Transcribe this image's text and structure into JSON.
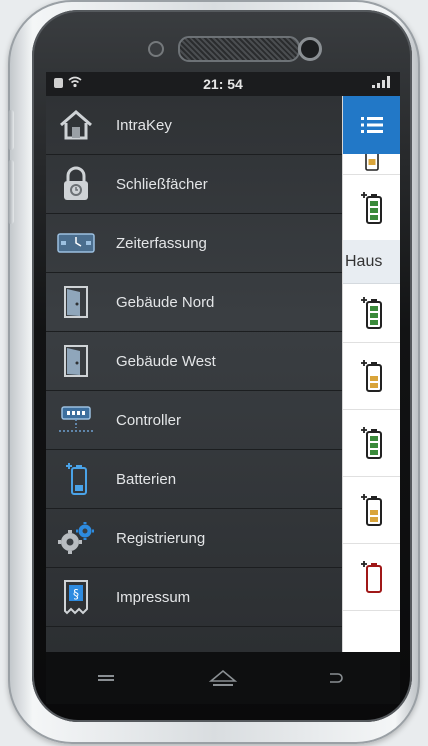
{
  "status_bar": {
    "time": "21: 54",
    "wifi_icon": "wifi-icon",
    "signal_icon": "signal-icon",
    "notification_icon": "notification-icon"
  },
  "drawer": {
    "items": [
      {
        "label": "IntraKey",
        "icon": "home-icon"
      },
      {
        "label": "Schließfächer",
        "icon": "lock-icon"
      },
      {
        "label": "Zeiterfassung",
        "icon": "time-tracking-icon"
      },
      {
        "label": "Gebäude Nord",
        "icon": "door-icon"
      },
      {
        "label": "Gebäude West",
        "icon": "door-icon"
      },
      {
        "label": "Controller",
        "icon": "controller-icon"
      },
      {
        "label": "Batterien",
        "icon": "battery-icon"
      },
      {
        "label": "Registrierung",
        "icon": "gears-icon"
      },
      {
        "label": "Impressum",
        "icon": "document-icon"
      }
    ]
  },
  "right_panel": {
    "menu_icon": "list-menu-icon",
    "section_label": "Haus",
    "battery_levels": [
      "medium",
      "full",
      "full",
      "medium",
      "full",
      "medium",
      "low"
    ]
  },
  "colors": {
    "accent": "#2278c7",
    "battery_full": "#3a8a3a",
    "battery_medium": "#d9a43a",
    "battery_low": "#a01818"
  },
  "nav_bar": {
    "menu_icon": "menu-icon",
    "home_icon": "home-nav-icon",
    "back_icon": "back-icon"
  }
}
